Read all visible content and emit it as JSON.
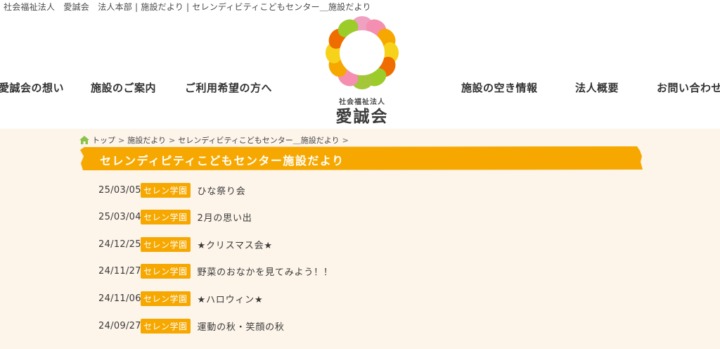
{
  "page": {
    "top_title": "社会福祉法人　愛誠会　法人本部 | 施設だより | セレンディビティこどもセンター＿施設だより"
  },
  "nav": {
    "left": [
      "愛誠会の想い",
      "施設のご案内",
      "ご利用希望の方へ"
    ],
    "right": [
      "施設の空き情報",
      "法人概要",
      "お問い合わせ"
    ]
  },
  "logo": {
    "sub": "社会福祉法人",
    "main": "愛誠会"
  },
  "breadcrumb": [
    "トップ",
    "施設だより",
    "セレンディビティこどもセンター＿施設だより"
  ],
  "banner": {
    "title": "セレンディピティこどもセンター施設だより"
  },
  "posts": [
    {
      "date": "25/03/05",
      "tag": "セレン学園",
      "title": "ひな祭り会"
    },
    {
      "date": "25/03/04",
      "tag": "セレン学園",
      "title": "2月の思い出"
    },
    {
      "date": "24/12/25",
      "tag": "セレン学園",
      "title": "★クリスマス会★"
    },
    {
      "date": "24/11/27",
      "tag": "セレン学園",
      "title": "野菜のおなかを見てみよう！！"
    },
    {
      "date": "24/11/06",
      "tag": "セレン学園",
      "title": "★ハロウィン★"
    },
    {
      "date": "24/09/27",
      "tag": "セレン学園",
      "title": "運動の秋・笑顔の秋"
    }
  ],
  "colors": {
    "accent": "#f6a800",
    "content_bg": "#fdf4ea"
  }
}
